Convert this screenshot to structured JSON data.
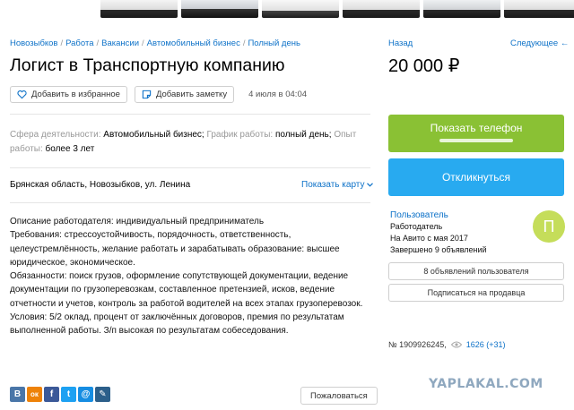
{
  "breadcrumbs": [
    "Новозыбков",
    "Работа",
    "Вакансии",
    "Автомобильный бизнес",
    "Полный день"
  ],
  "title": "Логист в Транспортную компанию",
  "actions": {
    "favorite_label": "Добавить в избранное",
    "note_label": "Добавить заметку",
    "date": "4 июля в 04:04"
  },
  "params": {
    "sphere_label": "Сфера деятельности:",
    "sphere_value": "Автомобильный бизнес;",
    "schedule_label": "График работы:",
    "schedule_value": "полный день;",
    "experience_label": "Опыт работы:",
    "experience_value": "более 3 лет"
  },
  "address": "Брянская область, Новозыбков, ул. Ленина",
  "show_map_label": "Показать карту",
  "description": [
    "Описание работодателя: индивидуальный предприниматель",
    "Требования: стрессоустойчивость, порядочность, ответственность, целеустремлённость, желание работать и зарабатывать образование: высшее юридическое, экономическое.",
    "Обязанности: поиск грузов, оформление сопутствующей документации, ведение документации по грузоперевозкам, составленное претензией, исков, ведение отчетности и учетов, контроль за работой водителей на всех этапах грузоперевозок.",
    "Условия: 5/2 оклад, процент от заключённых договоров, премия по результатам выполненной работы. З/п высокая по результатам собеседования."
  ],
  "share": [
    {
      "icon": "vk-icon",
      "glyph": "В",
      "color": "#4a76a8"
    },
    {
      "icon": "odnoklassniki-icon",
      "glyph": "ок",
      "color": "#ee8208"
    },
    {
      "icon": "facebook-icon",
      "glyph": "f",
      "color": "#3b5998"
    },
    {
      "icon": "twitter-icon",
      "glyph": "t",
      "color": "#1da1f2"
    },
    {
      "icon": "mailru-icon",
      "glyph": "@",
      "color": "#168de2"
    },
    {
      "icon": "livejournal-icon",
      "glyph": "✎",
      "color": "#2c5f8a"
    }
  ],
  "complain_label": "Пожаловаться",
  "nav": {
    "back_label": "Назад",
    "next_label": "Следующее ←"
  },
  "price": "20 000 ₽",
  "phone_button_label": "Показать телефон",
  "respond_button_label": "Откликнуться",
  "seller": {
    "name": "Пользователь",
    "role": "Работодатель",
    "since": "На Авито с мая 2017",
    "completed": "Завершено 9 объявлений",
    "avatar_letter": "П"
  },
  "user_ads_label": "8 объявлений пользователя",
  "subscribe_label": "Подписаться на продавца",
  "ad_number": "№ 1909926245,",
  "views": "1626 (+31)",
  "watermark": "YAPLAKAL.COM",
  "colors": {
    "link": "#0e72c8",
    "phone_button": "#8ac134",
    "respond_button": "#28aaf0",
    "avatar": "#c5dd5a"
  }
}
